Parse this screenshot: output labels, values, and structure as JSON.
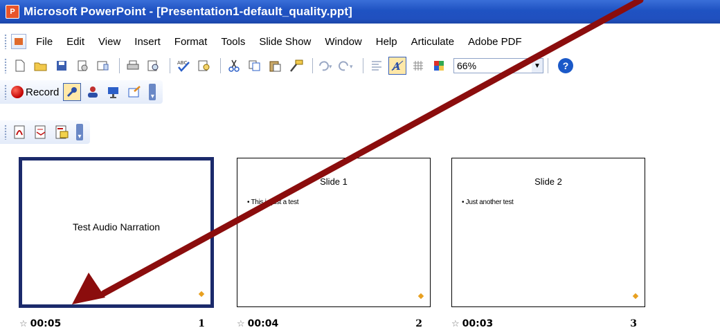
{
  "window": {
    "title": "Microsoft PowerPoint - [Presentation1-default_quality.ppt]"
  },
  "menubar": {
    "items": [
      "File",
      "Edit",
      "View",
      "Insert",
      "Format",
      "Tools",
      "Slide Show",
      "Window",
      "Help",
      "Articulate",
      "Adobe PDF"
    ]
  },
  "toolbar_standard": {
    "zoom_value": "66%",
    "icons": [
      "new-icon",
      "open-icon",
      "save-icon",
      "permission-icon",
      "email-icon",
      "print-icon",
      "print-preview-icon",
      "spelling-icon",
      "research-icon",
      "cut-icon",
      "copy-icon",
      "paste-icon",
      "format-painter-icon",
      "undo-icon",
      "redo-icon",
      "expand-icon",
      "show-formatting-icon",
      "grid-icon",
      "color-grayscale-icon",
      "help-icon"
    ]
  },
  "toolbar_narration": {
    "record_label": "Record",
    "icons": [
      "narration-pointer-icon",
      "narrator-icon",
      "presenter-icon",
      "publish-icon"
    ]
  },
  "toolbar_pdf": {
    "icons": [
      "convert-pdf-icon",
      "convert-email-pdf-icon",
      "review-pdf-icon"
    ]
  },
  "slides": [
    {
      "number": "1",
      "time": "00:05",
      "title": "",
      "bullet": "",
      "center_text": "Test Audio Narration",
      "selected": true
    },
    {
      "number": "2",
      "time": "00:04",
      "title": "Slide 1",
      "bullet": "• This is just a test",
      "center_text": "",
      "selected": false
    },
    {
      "number": "3",
      "time": "00:03",
      "title": "Slide 2",
      "bullet": "• Just another test",
      "center_text": "",
      "selected": false
    }
  ],
  "annotation": {
    "arrow_color": "#8b0d0d"
  }
}
